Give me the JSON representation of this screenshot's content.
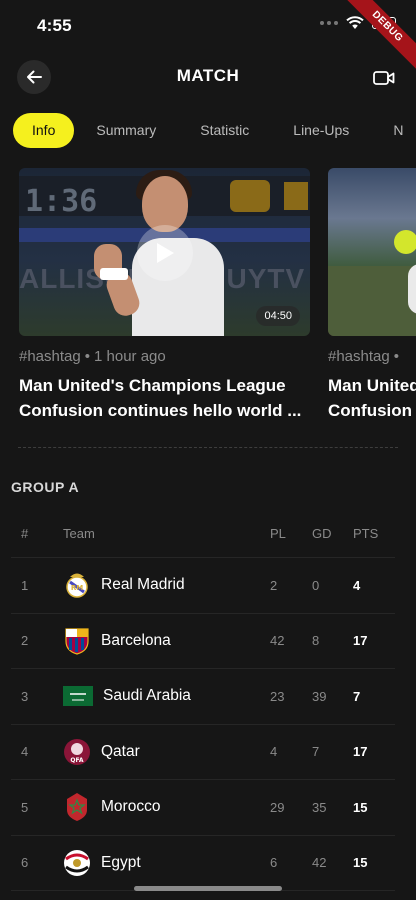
{
  "status_bar": {
    "time": "4:55"
  },
  "debug_banner": "DEBUG",
  "header": {
    "title": "MATCH"
  },
  "tabs": [
    {
      "label": "Info",
      "active": true
    },
    {
      "label": "Summary",
      "active": false
    },
    {
      "label": "Statistic",
      "active": false
    },
    {
      "label": "Line-Ups",
      "active": false
    },
    {
      "label": "N",
      "active": false
    }
  ],
  "news": [
    {
      "hashtag": "#hashtag",
      "time_ago": "1 hour ago",
      "headline_line1": "Man United's Champions League",
      "headline_line2": "Confusion continues hello world ...",
      "duration": "04:50"
    },
    {
      "hashtag": "#hashtag",
      "time_ago": "",
      "headline_line1": "Man United",
      "headline_line2": "Confusion c"
    }
  ],
  "group": {
    "title": "GROUP A",
    "columns": {
      "rank": "#",
      "team": "Team",
      "pl": "PL",
      "gd": "GD",
      "pts": "PTS"
    },
    "rows": [
      {
        "rank": "1",
        "team": "Real Madrid",
        "pl": "2",
        "gd": "0",
        "pts": "4",
        "logo": "real-madrid-crest"
      },
      {
        "rank": "2",
        "team": "Barcelona",
        "pl": "42",
        "gd": "8",
        "pts": "17",
        "logo": "barcelona-crest"
      },
      {
        "rank": "3",
        "team": "Saudi Arabia",
        "pl": "23",
        "gd": "39",
        "pts": "7",
        "logo": "saudi-arabia-flag"
      },
      {
        "rank": "4",
        "team": "Qatar",
        "pl": "4",
        "gd": "7",
        "pts": "17",
        "logo": "qatar-crest"
      },
      {
        "rank": "5",
        "team": "Morocco",
        "pl": "29",
        "gd": "35",
        "pts": "15",
        "logo": "morocco-crest"
      },
      {
        "rank": "6",
        "team": "Egypt",
        "pl": "6",
        "gd": "42",
        "pts": "15",
        "logo": "egypt-crest"
      }
    ]
  },
  "colors": {
    "background": "#161616",
    "accent": "#f5f01e",
    "text_muted": "#8a8a8a"
  }
}
